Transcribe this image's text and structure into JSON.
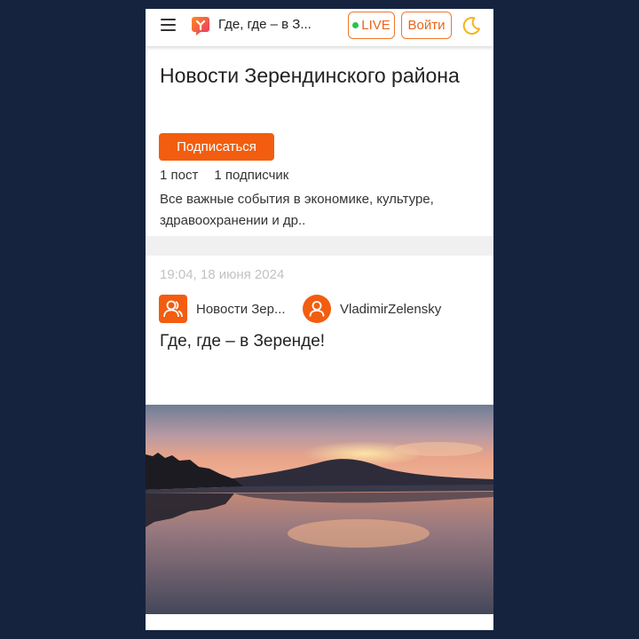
{
  "topbar": {
    "title": "Где, где – в З...",
    "live_label": "LIVE",
    "login_label": "Войти",
    "icons": [
      "menu-icon",
      "logo-icon",
      "moon-icon"
    ],
    "colors": {
      "accent": "#f0782a",
      "live_dot": "#2fc24a",
      "moon": "#f2b51c"
    }
  },
  "channel": {
    "title": "Новости Зерендинского района",
    "subscribe_label": "Подписаться",
    "posts_count": "1 пост",
    "subscribers_count": "1 подписчик",
    "description": "Все важные события в экономике, культуре, здравоохранении и др.."
  },
  "post": {
    "time": "19:04, 18 июня 2024",
    "channel_name": "Новости Зер...",
    "author": "VladimirZelensky",
    "title": "Где, где – в Зеренде!",
    "image_alt": "sunset over lake"
  },
  "colors": {
    "background": "#16233f",
    "brand_orange": "#f25d0f"
  }
}
